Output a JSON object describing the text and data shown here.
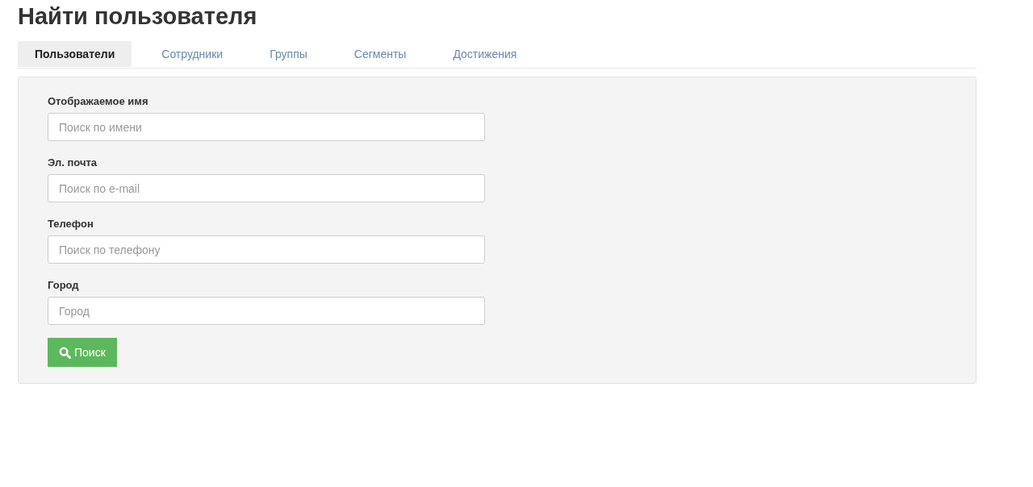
{
  "title": "Найти пользователя",
  "tabs": [
    {
      "label": "Пользователи",
      "selected": true
    },
    {
      "label": "Сотрудники",
      "selected": false
    },
    {
      "label": "Группы",
      "selected": false
    },
    {
      "label": "Сегменты",
      "selected": false
    },
    {
      "label": "Достижения",
      "selected": false
    }
  ],
  "form": {
    "fields": [
      {
        "label": "Отображаемое имя",
        "placeholder": "Поиск по имени"
      },
      {
        "label": "Эл. почта",
        "placeholder": "Поиск по e-mail"
      },
      {
        "label": "Телефон",
        "placeholder": "Поиск по телефону"
      },
      {
        "label": "Город",
        "placeholder": "Город"
      }
    ],
    "button": "Поиск"
  }
}
